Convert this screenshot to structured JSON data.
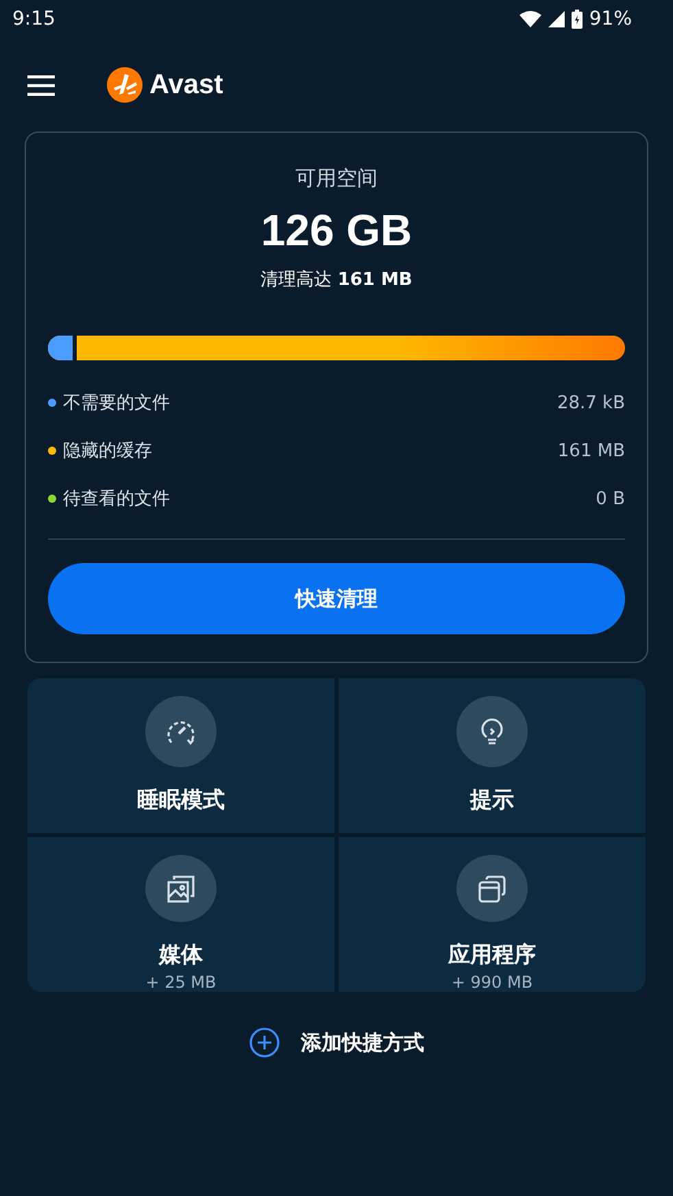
{
  "status_bar": {
    "time": "9:15",
    "battery": "91%"
  },
  "header": {
    "app_name": "Avast"
  },
  "storage_card": {
    "label": "可用空间",
    "free": "126 GB",
    "cleanup_prefix": "清理高达",
    "cleanup_amount": "161 MB",
    "categories": [
      {
        "name": "不需要的文件",
        "size": "28.7 kB",
        "color": "#4a9cff",
        "level": 0.05
      },
      {
        "name": "隐藏的缓存",
        "size": "161 MB",
        "color": "#ffb800"
      },
      {
        "name": "待查看的文件",
        "size": "0 B",
        "color": "#8fd43a"
      }
    ],
    "button": "快速清理"
  },
  "tiles": [
    {
      "kind": "gauge",
      "title": "睡眠模式"
    },
    {
      "kind": "bulb",
      "title": "提示"
    },
    {
      "kind": "images",
      "title": "媒体",
      "subtitle": "+ 25 MB"
    },
    {
      "kind": "windows",
      "title": "应用程序",
      "subtitle": "+ 990 MB"
    }
  ],
  "add_shortcut": "添加快捷方式"
}
